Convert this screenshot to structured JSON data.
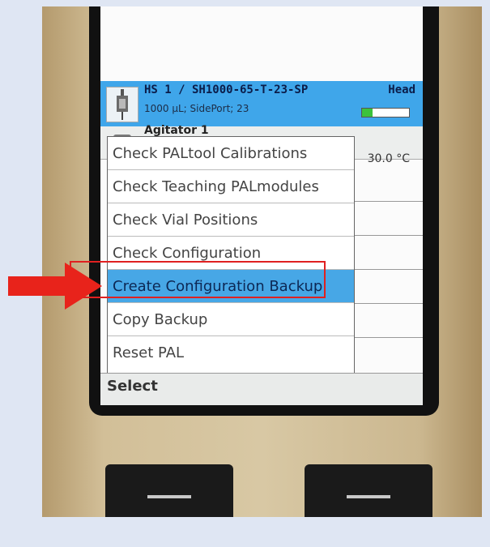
{
  "device_screen": {
    "tool_row": {
      "title": "HS 1 / SH1000-65-T-23-SP",
      "status": "Head",
      "subtitle": "1000 µL; SidePort; 23",
      "level_fraction": 0.22,
      "icon": "syringe-icon"
    },
    "agitator_row": {
      "title": "Agitator 1",
      "temperature": "30.0 °C",
      "icon": "agitator-icon"
    },
    "menu": {
      "items": [
        {
          "label": "Check PALtool Calibrations"
        },
        {
          "label": "Check Teaching PALmodules"
        },
        {
          "label": "Check Vial Positions"
        },
        {
          "label": "Check Configuration"
        },
        {
          "label": "Create Configuration Backup",
          "selected": true
        },
        {
          "label": "Copy Backup"
        },
        {
          "label": "Reset PAL"
        }
      ]
    },
    "softkey_label": "Select"
  },
  "annotations": {
    "arrow_color": "#e8231b",
    "highlight_color": "#e02020"
  },
  "colors": {
    "selection": "#47a7e6",
    "header_row": "#3fa6ea",
    "background": "#dfe6f3"
  }
}
